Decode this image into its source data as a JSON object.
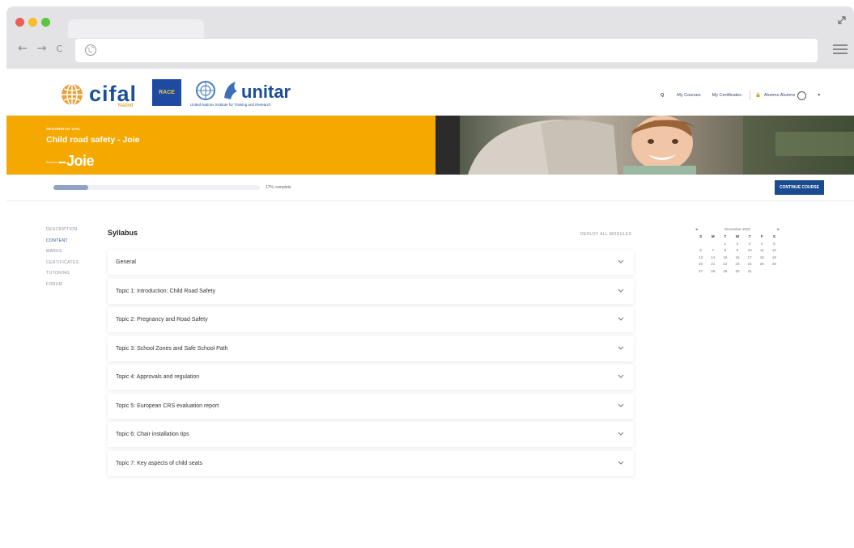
{
  "browser": {
    "nav_arrows": [
      "←",
      "→",
      "C"
    ],
    "icons": [
      "close-dot",
      "minimize-dot",
      "maximize-dot",
      "expand-icon",
      "globe-icon",
      "menu-icon"
    ],
    "traffic_colors": [
      "#ec5f56",
      "#f5bd2e",
      "#5bc640"
    ]
  },
  "header": {
    "logo_cifal": "cifal",
    "logo_cifal_sub": "Madrid",
    "logo_race": "RACE",
    "logo_unitar": "unitar",
    "logo_unitar_sub": "United Nations Institute for Training and Research",
    "search_icon": "Q",
    "links": [
      "My Courses",
      "My Certificates"
    ],
    "user_name": "Alumno Alumno"
  },
  "banner": {
    "kicker": "SEGURIDAD VIAL",
    "title": "Child road safety - Joie",
    "powered": "Powered by",
    "brand": "Joie",
    "color": "#f5a800"
  },
  "progress": {
    "fraction": 0.17,
    "label": "17% complete",
    "button": "CONTINUE COURSE"
  },
  "left_nav": {
    "items": [
      "DESCRIPTION",
      "CONTENT",
      "MARKS",
      "CERTIFICATES",
      "TUTORING",
      "FORUM"
    ],
    "active_index": 1
  },
  "syllabus": {
    "title": "Syllabus",
    "deploy_label": "DEPLOY ALL MODULES",
    "modules": [
      "General",
      "Topic 1: Introduction: Child Road Safety",
      "Topic 2: Pregnancy and Road Safety",
      "Topic 3: School Zones and Safe School Path",
      "Topic 4: Approvals and regulation",
      "Topic 5: European CRS evaluation report",
      "Topic 6: Chair installation tips",
      "Topic 7: Key aspects of child seats"
    ]
  },
  "calendar": {
    "prev": "◄",
    "next": "►",
    "month": "December 2020",
    "day_headers": [
      "S",
      "M",
      "T",
      "W",
      "T",
      "F",
      "S"
    ],
    "cells": [
      "",
      "",
      "1",
      "2",
      "3",
      "4",
      "5",
      "6",
      "7",
      "8",
      "9",
      "10",
      "11",
      "12",
      "13",
      "14",
      "15",
      "16",
      "17",
      "18",
      "19",
      "20",
      "21",
      "22",
      "23",
      "24",
      "25",
      "26",
      "27",
      "28",
      "29",
      "30",
      "31",
      "",
      ""
    ]
  }
}
